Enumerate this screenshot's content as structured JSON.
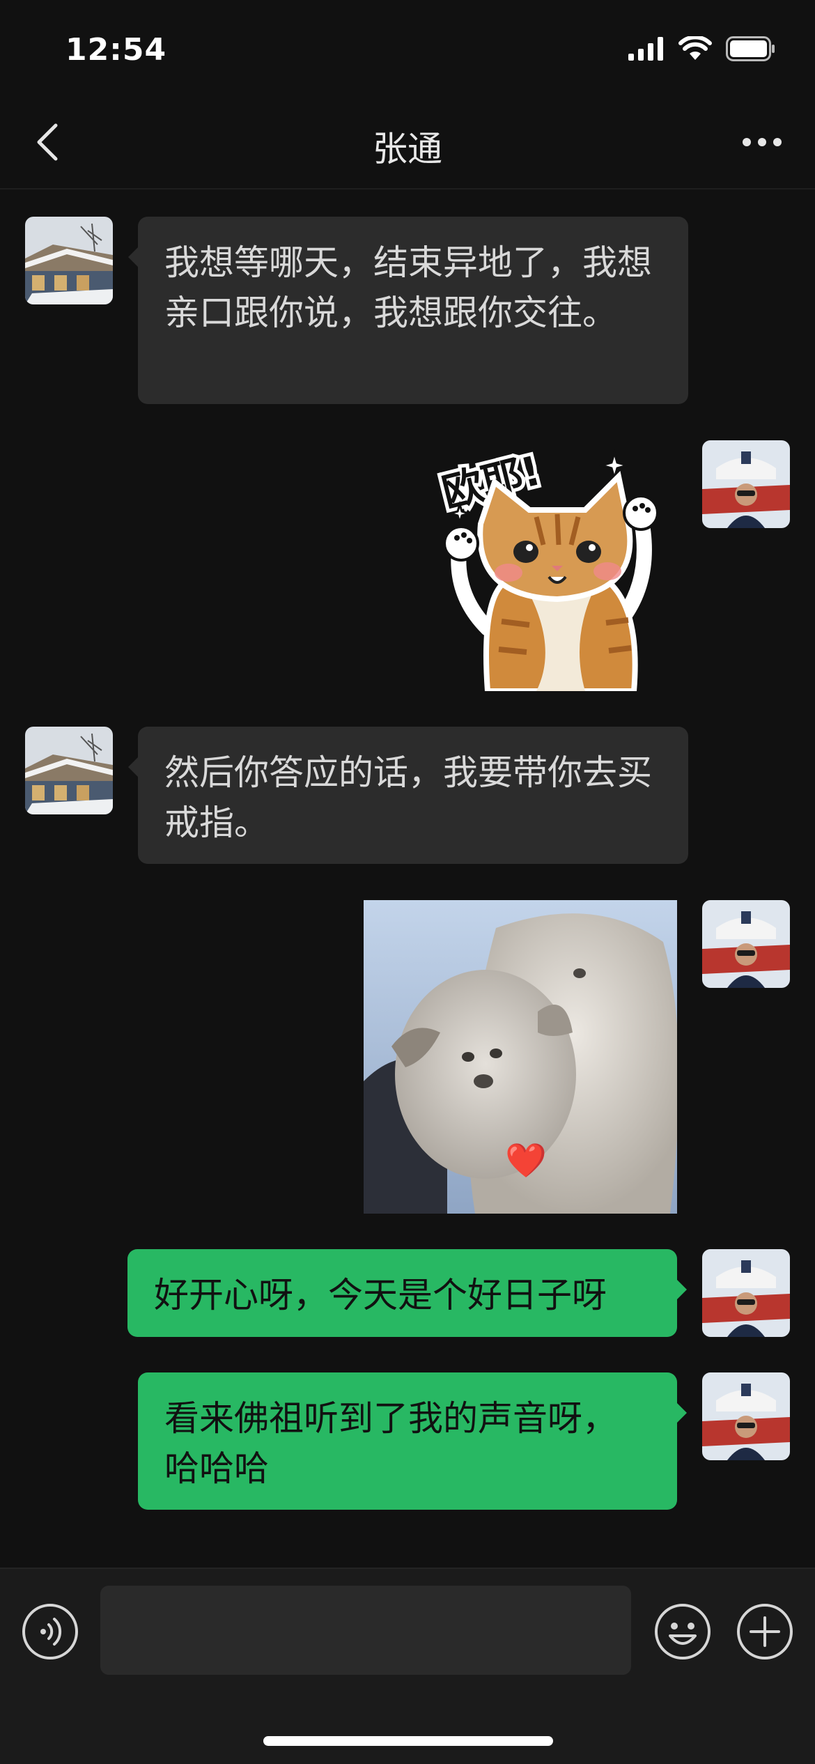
{
  "status_bar": {
    "time": "12:54",
    "icons": [
      "signal-icon",
      "wifi-icon",
      "battery-icon"
    ]
  },
  "nav": {
    "title": "张通",
    "back_icon": "chevron-left-icon",
    "more_icon": "more-dots-icon"
  },
  "messages": [
    {
      "side": "incoming",
      "type": "text",
      "text": "我想等哪天，结束异地了，我想亲口跟你说，我想跟你交往。"
    },
    {
      "side": "outgoing",
      "type": "sticker",
      "caption": "欧耶!"
    },
    {
      "side": "incoming",
      "type": "text",
      "text": "然后你答应的话，我要带你去买戒指。"
    },
    {
      "side": "outgoing",
      "type": "image",
      "overlay": "❤️"
    },
    {
      "side": "outgoing",
      "type": "text",
      "text": "好开心呀，今天是个好日子呀"
    },
    {
      "side": "outgoing",
      "type": "text",
      "text": "看来佛祖听到了我的声音呀，哈哈哈"
    }
  ],
  "input_bar": {
    "voice_icon": "voice-icon",
    "placeholder": "",
    "emoji_icon": "emoji-icon",
    "plus_icon": "plus-icon"
  },
  "colors": {
    "background": "#111111",
    "incoming_bubble": "#2c2c2c",
    "outgoing_bubble": "#28b863",
    "input_bar": "#1b1b1b"
  }
}
